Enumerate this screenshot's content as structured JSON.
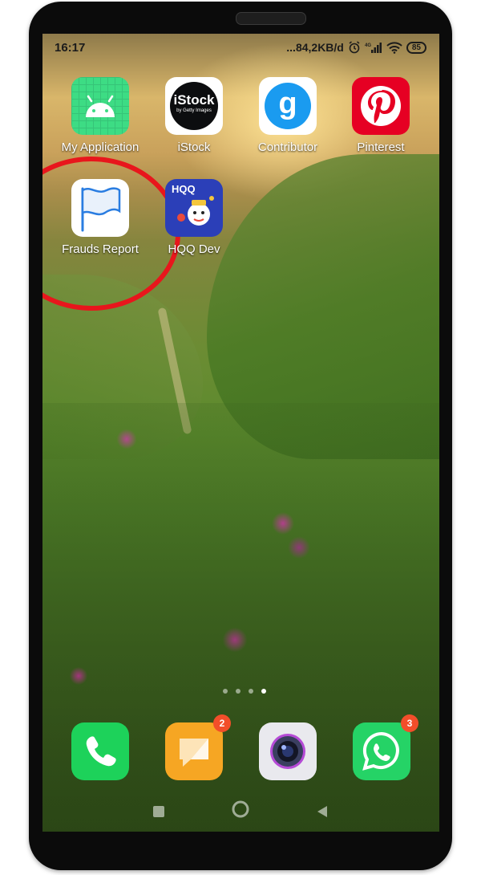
{
  "status_bar": {
    "time": "16:17",
    "network_speed": "...84,2KB/d",
    "battery": "85",
    "signal_label": "4G"
  },
  "home_apps": [
    {
      "label": "My Application",
      "icon": "android-icon"
    },
    {
      "label": "iStock",
      "icon": "istock-icon",
      "logo_text": "iStock",
      "logo_subtext": "by Getty Images"
    },
    {
      "label": "Contributor",
      "icon": "contributor-icon",
      "logo_text": "g"
    },
    {
      "label": "Pinterest",
      "icon": "pinterest-icon"
    },
    {
      "label": "Frauds Report",
      "icon": "flag-icon"
    },
    {
      "label": "HQQ Dev",
      "icon": "hqq-icon",
      "logo_text": "HQQ"
    }
  ],
  "highlight": {
    "color": "#e8161c",
    "target": "Frauds Report"
  },
  "page_indicator": {
    "pages": 4,
    "active": 4
  },
  "dock": [
    {
      "name": "Phone",
      "icon": "phone-icon",
      "color": "#1dd25a"
    },
    {
      "name": "Messages",
      "icon": "messages-icon",
      "color": "#f6a623",
      "badge": "2"
    },
    {
      "name": "Camera",
      "icon": "camera-icon",
      "color": "#e9e9ee"
    },
    {
      "name": "WhatsApp",
      "icon": "whatsapp-icon",
      "color": "#25d366",
      "badge": "3"
    }
  ],
  "nav": [
    "recent-apps-button",
    "home-button",
    "back-button"
  ]
}
